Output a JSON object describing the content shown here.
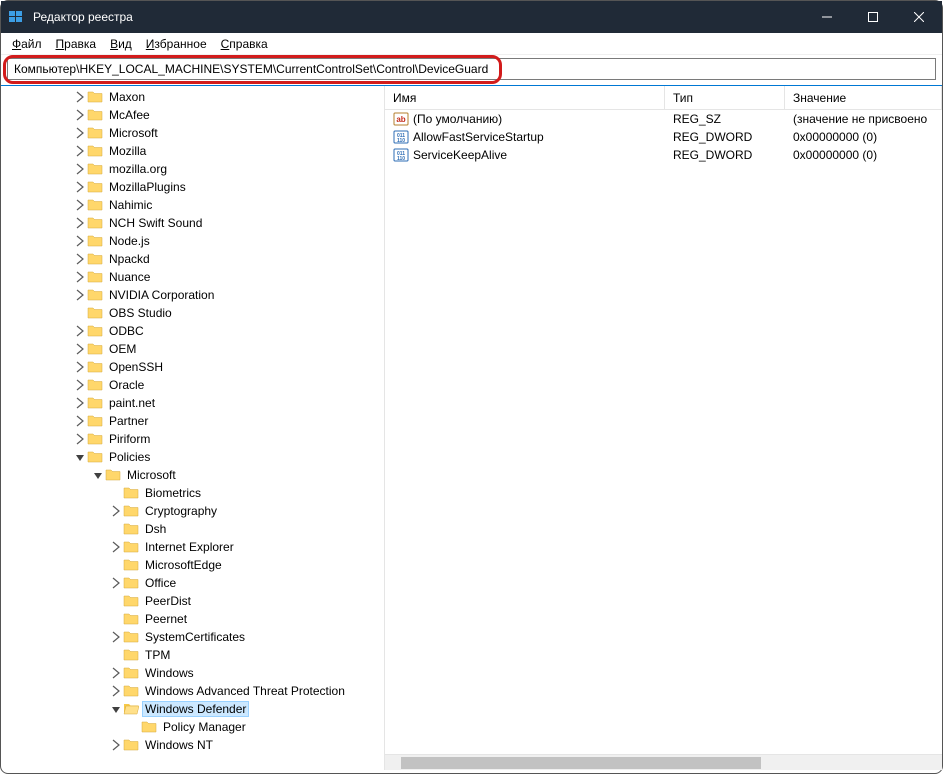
{
  "window": {
    "title": "Редактор реестра"
  },
  "menu": {
    "file": "Файл",
    "edit": "Правка",
    "view": "Вид",
    "fav": "Избранное",
    "help": "Справка"
  },
  "address": "Компьютер\\HKEY_LOCAL_MACHINE\\SYSTEM\\CurrentControlSet\\Control\\DeviceGuard",
  "columns": {
    "name": "Имя",
    "type": "Тип",
    "value": "Значение"
  },
  "tree": [
    {
      "d": 4,
      "chev": "r",
      "label": "Maxon"
    },
    {
      "d": 4,
      "chev": "r",
      "label": "McAfee"
    },
    {
      "d": 4,
      "chev": "r",
      "label": "Microsoft"
    },
    {
      "d": 4,
      "chev": "r",
      "label": "Mozilla"
    },
    {
      "d": 4,
      "chev": "r",
      "label": "mozilla.org"
    },
    {
      "d": 4,
      "chev": "r",
      "label": "MozillaPlugins"
    },
    {
      "d": 4,
      "chev": "r",
      "label": "Nahimic"
    },
    {
      "d": 4,
      "chev": "r",
      "label": "NCH Swift Sound"
    },
    {
      "d": 4,
      "chev": "r",
      "label": "Node.js"
    },
    {
      "d": 4,
      "chev": "r",
      "label": "Npackd"
    },
    {
      "d": 4,
      "chev": "r",
      "label": "Nuance"
    },
    {
      "d": 4,
      "chev": "r",
      "label": "NVIDIA Corporation"
    },
    {
      "d": 4,
      "chev": "n",
      "label": "OBS Studio"
    },
    {
      "d": 4,
      "chev": "r",
      "label": "ODBC"
    },
    {
      "d": 4,
      "chev": "r",
      "label": "OEM"
    },
    {
      "d": 4,
      "chev": "r",
      "label": "OpenSSH"
    },
    {
      "d": 4,
      "chev": "r",
      "label": "Oracle"
    },
    {
      "d": 4,
      "chev": "r",
      "label": "paint.net"
    },
    {
      "d": 4,
      "chev": "r",
      "label": "Partner"
    },
    {
      "d": 4,
      "chev": "r",
      "label": "Piriform"
    },
    {
      "d": 4,
      "chev": "d",
      "label": "Policies"
    },
    {
      "d": 5,
      "chev": "d",
      "label": "Microsoft"
    },
    {
      "d": 6,
      "chev": "n",
      "label": "Biometrics"
    },
    {
      "d": 6,
      "chev": "r",
      "label": "Cryptography"
    },
    {
      "d": 6,
      "chev": "n",
      "label": "Dsh"
    },
    {
      "d": 6,
      "chev": "r",
      "label": "Internet Explorer"
    },
    {
      "d": 6,
      "chev": "n",
      "label": "MicrosoftEdge"
    },
    {
      "d": 6,
      "chev": "r",
      "label": "Office"
    },
    {
      "d": 6,
      "chev": "n",
      "label": "PeerDist"
    },
    {
      "d": 6,
      "chev": "n",
      "label": "Peernet"
    },
    {
      "d": 6,
      "chev": "r",
      "label": "SystemCertificates"
    },
    {
      "d": 6,
      "chev": "n",
      "label": "TPM"
    },
    {
      "d": 6,
      "chev": "r",
      "label": "Windows"
    },
    {
      "d": 6,
      "chev": "r",
      "label": "Windows Advanced Threat Protection"
    },
    {
      "d": 6,
      "chev": "d",
      "label": "Windows Defender",
      "selected": true,
      "open": true
    },
    {
      "d": 7,
      "chev": "n",
      "label": "Policy Manager"
    },
    {
      "d": 6,
      "chev": "r",
      "label": "Windows NT"
    }
  ],
  "values": [
    {
      "icon": "str",
      "name": "(По умолчанию)",
      "type": "REG_SZ",
      "value": "(значение не присвоено"
    },
    {
      "icon": "bin",
      "name": "AllowFastServiceStartup",
      "type": "REG_DWORD",
      "value": "0x00000000 (0)"
    },
    {
      "icon": "bin",
      "name": "ServiceKeepAlive",
      "type": "REG_DWORD",
      "value": "0x00000000 (0)"
    }
  ]
}
